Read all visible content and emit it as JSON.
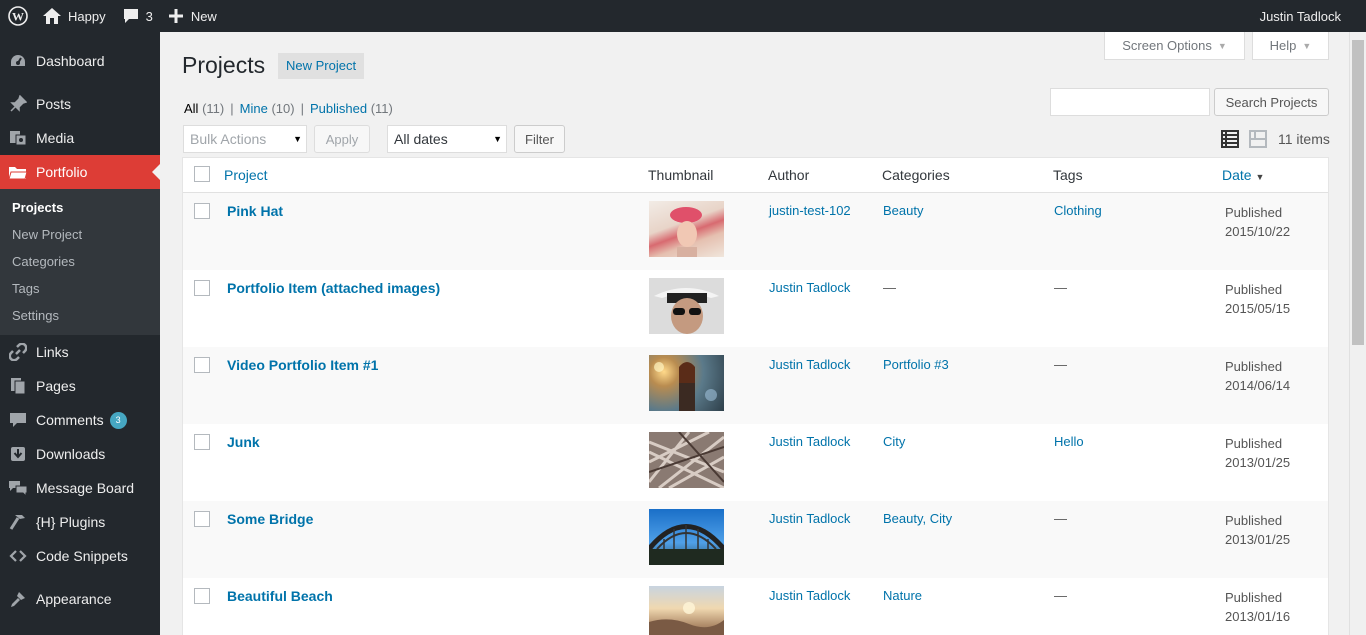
{
  "adminbar": {
    "site_name": "Happy",
    "comments_count": "3",
    "new_label": "New",
    "user_name": "Justin Tadlock"
  },
  "sidebar": {
    "items": [
      {
        "label": "Dashboard",
        "icon": "dashboard-icon"
      },
      {
        "label": "Posts",
        "icon": "pin-icon"
      },
      {
        "label": "Media",
        "icon": "media-icon"
      },
      {
        "label": "Portfolio",
        "icon": "folder-icon"
      },
      {
        "label": "Links",
        "icon": "link-icon"
      },
      {
        "label": "Pages",
        "icon": "pages-icon"
      },
      {
        "label": "Comments",
        "icon": "comment-icon",
        "badge": "3"
      },
      {
        "label": "Downloads",
        "icon": "download-icon"
      },
      {
        "label": "Message Board",
        "icon": "chat-icon"
      },
      {
        "label": "{H} Plugins",
        "icon": "hammer-icon"
      },
      {
        "label": "Code Snippets",
        "icon": "code-icon"
      },
      {
        "label": "Appearance",
        "icon": "brush-icon"
      }
    ],
    "submenu": [
      "Projects",
      "New Project",
      "Categories",
      "Tags",
      "Settings"
    ]
  },
  "screen_options": "Screen Options",
  "help": "Help",
  "page": {
    "title": "Projects",
    "add_new": "New Project"
  },
  "filters": {
    "all": "All",
    "all_count": "(11)",
    "mine": "Mine",
    "mine_count": "(10)",
    "published": "Published",
    "published_count": "(11)"
  },
  "search": {
    "value": "",
    "button": "Search Projects"
  },
  "toolbar": {
    "bulk_actions": "Bulk Actions",
    "apply": "Apply",
    "dates": "All dates",
    "filter": "Filter",
    "items_count": "11 items"
  },
  "table": {
    "columns": [
      "Project",
      "Thumbnail",
      "Author",
      "Categories",
      "Tags",
      "Date"
    ],
    "rows": [
      {
        "title": "Pink Hat",
        "author": "justin-test-102",
        "categories": "Beauty",
        "tags": "Clothing",
        "status": "Published",
        "date": "2015/10/22"
      },
      {
        "title": "Portfolio Item (attached images)",
        "author": "Justin Tadlock",
        "categories": "—",
        "tags": "—",
        "status": "Published",
        "date": "2015/05/15"
      },
      {
        "title": "Video Portfolio Item #1",
        "author": "Justin Tadlock",
        "categories": "Portfolio #3",
        "tags": "—",
        "status": "Published",
        "date": "2014/06/14"
      },
      {
        "title": "Junk",
        "author": "Justin Tadlock",
        "categories": "City",
        "tags": "Hello",
        "status": "Published",
        "date": "2013/01/25"
      },
      {
        "title": "Some Bridge",
        "author": "Justin Tadlock",
        "categories": "Beauty, City",
        "tags": "—",
        "status": "Published",
        "date": "2013/01/25"
      },
      {
        "title": "Beautiful Beach",
        "author": "Justin Tadlock",
        "categories": "Nature",
        "tags": "—",
        "status": "Published",
        "date": "2013/01/16"
      }
    ]
  },
  "colors": {
    "adminbar_bg": "#23282d",
    "current_menu": "#dd3d36",
    "link": "#0073aa",
    "badge": "#46a7c2"
  }
}
